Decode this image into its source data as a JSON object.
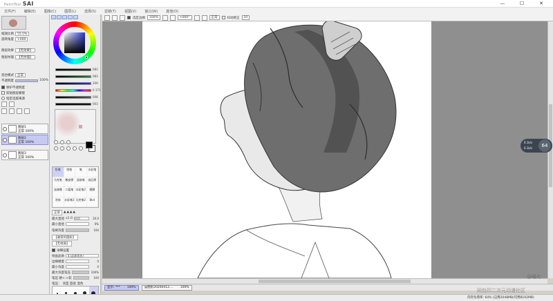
{
  "app": {
    "logo": "SAI",
    "logo_prefix": "PaintTool"
  },
  "window_controls": [
    "—",
    "☐",
    "✕"
  ],
  "menu": [
    "文件(F)",
    "编辑(E)",
    "图像(C)",
    "图层(L)",
    "选择(S)",
    "滤镜(T)",
    "视图(V)",
    "窗口(W)",
    "其他(O)"
  ],
  "navigator": {
    "zoom_label": "缩放比例",
    "zoom_value": "55.5%",
    "angle_label": "旋转角度",
    "angle_value": "+000",
    "fill_label": "图层效果",
    "fill_value": "【无效果】",
    "texture_label": "图层纹理",
    "texture_value": "【无纹理】",
    "blend_label": "混合模式",
    "blend_value": "正常",
    "opacity_label": "不透明度",
    "opacity_value": "100%",
    "opt1": "保护不透明度",
    "opt2": "剪贴图层蒙版",
    "opt3": "指定选取来源"
  },
  "layers": [
    {
      "name": "图层1",
      "mode": "正常",
      "opacity": "100%"
    },
    {
      "name": "图层2",
      "mode": "正常",
      "opacity": "100%"
    },
    {
      "name": "图层3",
      "mode": "正常",
      "opacity": "100%"
    }
  ],
  "color": {
    "sliders": [
      {
        "value": "083",
        "color": "#2a2a2a"
      },
      {
        "value": "083",
        "color": "#2f7f2f"
      },
      {
        "value": "209",
        "color": "#2a3ad8"
      },
      {
        "value": "0.171",
        "color": "rainbow"
      },
      {
        "value": "008",
        "color": "#555555"
      },
      {
        "value": "003",
        "color": "#111111"
      }
    ],
    "primary": "#000000",
    "secondary": "#ffffff"
  },
  "brushes": [
    "铅笔",
    "喷枪",
    "笔",
    "水彩笔",
    "马克笔",
    "橡皮擦",
    "选取笔",
    "选区擦",
    "油漆桶",
    "二值笔",
    "水彩笔2",
    "模糊",
    "涂抹",
    "水彩笔3",
    "马克笔2",
    "Bkd"
  ],
  "brush_params": {
    "mode_value": "正常",
    "size_label": "最大直径",
    "size_mult": "x1.0",
    "size_value": "20.0",
    "min_label": "最小直径",
    "min_value": "0%",
    "density_label": "笔刷浓度",
    "density_value": "100",
    "shape_label": "【通常的圆形】",
    "texture_label": "【无材质】",
    "detail_label": "详细设置",
    "quality_label": "绘画品质",
    "quality_value": "4 (品质优先)",
    "edge_label": "边缘硬度",
    "edge_value": "0",
    "min_density_label": "最小浓度",
    "min_density_value": "0",
    "max_pressure_label": "最大浓度笔压",
    "max_pressure_value": "100%",
    "pressure_label": "笔压 硬<->软",
    "pressure_value": "100",
    "pressure2_label": "笔压：",
    "pressure2_opts": "浓度  直径  混色"
  },
  "tips": [
    "1",
    "1.5",
    "2",
    "2.3",
    "2.6"
  ],
  "canvas_toolbar": {
    "select_label": "选区边缘",
    "zoom": "100%",
    "angle": "+000°",
    "mode": "正常",
    "stab_label": "抖动修正",
    "stab_value": "10"
  },
  "view_tabs": [
    {
      "label": "显示: ***",
      "value": "100%"
    },
    {
      "label": "@图形20200412....",
      "value": "100%"
    }
  ],
  "status": {
    "memory": "内存负荷率: 64%  (已用2048MB/可用8192MB)"
  },
  "float_badge": {
    "number": "64",
    "r1": "0.1k/s",
    "r2": "0.1k/s"
  },
  "watermark1": "@喵七",
  "watermark2": "同包印二次元动漫社区"
}
